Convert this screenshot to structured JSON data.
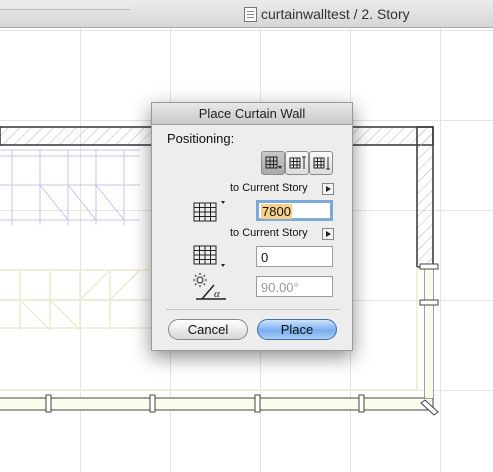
{
  "window": {
    "title": "curtainwalltest / 2. Story"
  },
  "dialog": {
    "title": "Place Curtain Wall",
    "positioning_label": "Positioning:",
    "top_link_label": "to Current Story",
    "height_value": "7800",
    "bottom_link_label": "to Current Story",
    "offset_value": "0",
    "angle_value": "90.00°",
    "cancel_label": "Cancel",
    "place_label": "Place",
    "anchor_modes": [
      "anchor-mode-top",
      "anchor-mode-center",
      "anchor-mode-bottom"
    ],
    "selected_anchor_mode": "anchor-mode-top"
  },
  "colors": {
    "accent": "#79aef0",
    "field_highlight": "#f7d08a",
    "wall_hatch": "#bdbdbd",
    "ghost_frame": "#c9c9f0",
    "ghost_panel": "#eeeed0"
  }
}
